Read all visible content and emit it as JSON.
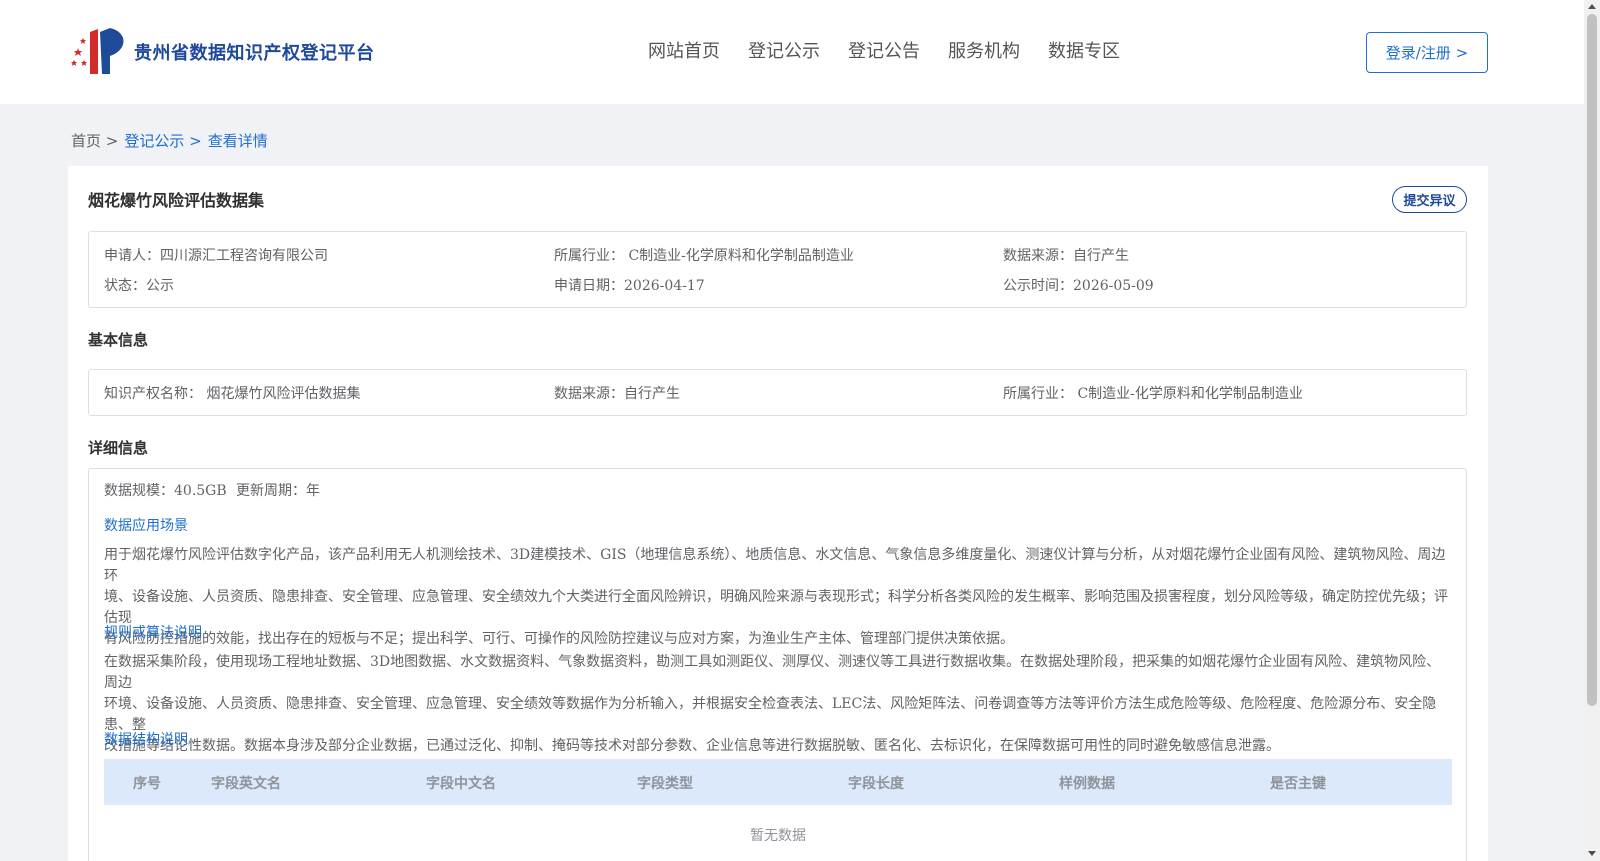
{
  "header": {
    "logo_text": "贵州省数据知识产权登记平台",
    "nav": [
      "网站首页",
      "登记公示",
      "登记公告",
      "服务机构",
      "数据专区"
    ],
    "login_label": "登录/注册 >"
  },
  "breadcrumb": {
    "home": "首页 >",
    "publicity": "登记公示 >",
    "current": "查看详情"
  },
  "detail": {
    "title": "烟花爆竹风险评估数据集",
    "objection_label": "提交异议",
    "summary": {
      "applicant": "申请人：四川源汇工程咨询有限公司",
      "industry": "所属行业： C制造业-化学原料和化学制品制造业",
      "data_source": "数据来源：自行产生",
      "status": "状态：公示",
      "apply_date": "申请日期：2026-04-17",
      "publicity_time": "公示时间：2026-05-09"
    },
    "basic_title": "基本信息",
    "basic": {
      "ip_name": "知识产权名称： 烟花爆竹风险评估数据集",
      "data_source": "数据来源：自行产生",
      "industry": "所属行业： C制造业-化学原料和化学制品制造业"
    },
    "detail_title": "详细信息",
    "scale": "数据规模：40.5GB",
    "cycle": "更新周期：年",
    "scenario_title": "数据应用场景",
    "scenario_lines": [
      "用于烟花爆竹风险评估数字化产品，该产品利用无人机测绘技术、3D建模技术、GIS（地理信息系统）、地质信息、水文信息、气象信息多维度量化、测速仪计算与分析，从对烟花爆竹企业固有风险、建筑物风险、周边环",
      "境、设备设施、人员资质、隐患排查、安全管理、应急管理、安全绩效九个大类进行全面风险辨识，明确风险来源与表现形式；科学分析各类风险的发生概率、影响范围及损害程度，划分风险等级，确定防控优先级；评估现",
      "有风险防控措施的效能，找出存在的短板与不足；提出科学、可行、可操作的风险防控建议与应对方案，为渔业生产主体、管理部门提供决策依据。"
    ],
    "algorithm_title": "规则或算法说明",
    "algorithm_lines": [
      "在数据采集阶段，使用现场工程地址数据、3D地图数据、水文数据资料、气象数据资料，勘测工具如测距仪、测厚仪、测速仪等工具进行数据收集。在数据处理阶段，把采集的如烟花爆竹企业固有风险、建筑物风险、周边",
      "环境、设备设施、人员资质、隐患排查、安全管理、应急管理、安全绩效等数据作为分析输入，并根据安全检查表法、LEC法、风险矩阵法、问卷调查等方法等评价方法生成危险等级、危险程度、危险源分布、安全隐患、整",
      "改措施等结论性数据。数据本身涉及部分企业数据，已通过泛化、抑制、掩码等技术对部分参数、企业信息等进行数据脱敏、匿名化、去标识化，在保障数据可用性的同时避免敏感信息泄露。"
    ],
    "structure_title": "数据结构说明",
    "table_headers": [
      "序号",
      "字段英文名",
      "字段中文名",
      "字段类型",
      "字段长度",
      "样例数据",
      "是否主键"
    ],
    "empty_text": "暂无数据"
  }
}
